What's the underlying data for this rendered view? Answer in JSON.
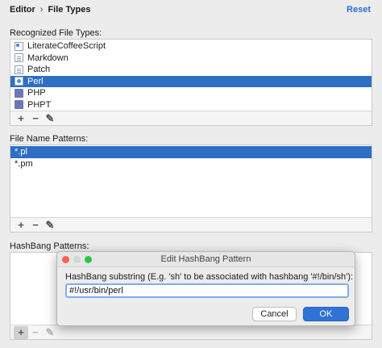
{
  "breadcrumb": {
    "parent": "Editor",
    "separator": "›",
    "current": "File Types"
  },
  "reset_label": "Reset",
  "recognized": {
    "label": "Recognized File Types:",
    "items": [
      {
        "label": "LiterateCoffeeScript",
        "icon": "coffeescript-file-icon",
        "selected": false
      },
      {
        "label": "Markdown",
        "icon": "markdown-file-icon",
        "selected": false
      },
      {
        "label": "Patch",
        "icon": "patch-file-icon",
        "selected": false
      },
      {
        "label": "Perl",
        "icon": "perl-file-icon",
        "selected": true
      },
      {
        "label": "PHP",
        "icon": "php-file-icon",
        "selected": false
      },
      {
        "label": "PHPT",
        "icon": "php-file-icon",
        "selected": false
      }
    ]
  },
  "patterns": {
    "label": "File Name Patterns:",
    "items": [
      {
        "label": "*.pl",
        "selected": true
      },
      {
        "label": "*.pm",
        "selected": false
      }
    ]
  },
  "hashbang": {
    "label": "HashBang Patterns:"
  },
  "toolbar": {
    "add": "+",
    "remove": "−",
    "edit": "✎"
  },
  "dialog": {
    "title": "Edit HashBang Pattern",
    "prompt": "HashBang substring (E.g. 'sh' to be associated with hashbang '#!/bin/sh'):",
    "value": "#!/usr/bin/perl",
    "cancel": "Cancel",
    "ok": "OK"
  },
  "colors": {
    "selection": "#2e6fc4",
    "accent": "#2f74d5",
    "link": "#2a6fd6"
  }
}
